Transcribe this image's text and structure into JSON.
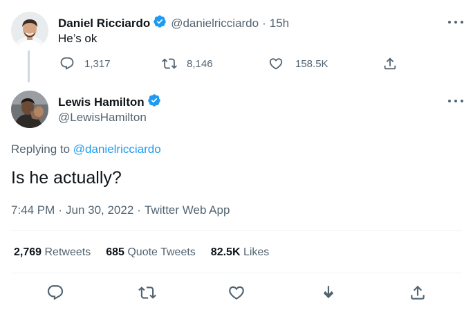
{
  "parent_tweet": {
    "author_name": "Daniel Ricciardo",
    "author_handle": "@danielricciardo",
    "separator": "·",
    "time_ago": "15h",
    "text": "He’s ok",
    "reply_count": "1,317",
    "retweet_count": "8,146",
    "like_count": "158.5K"
  },
  "main_tweet": {
    "author_name": "Lewis Hamilton",
    "author_handle": "@LewisHamilton",
    "replying_prefix": "Replying to",
    "replying_handle": "@danielricciardo",
    "text": "Is he actually?",
    "time": "7:44 PM",
    "date": "Jun 30, 2022",
    "source": "Twitter Web App",
    "meta_separator": "·",
    "stats": {
      "retweets_value": "2,769",
      "retweets_label": "Retweets",
      "quotes_value": "685",
      "quotes_label": "Quote Tweets",
      "likes_value": "82.5K",
      "likes_label": "Likes"
    }
  },
  "colors": {
    "link": "#1d9bf0",
    "verified": "#1d9bf0",
    "secondary_text": "#536471",
    "primary_text": "#0f1419",
    "divider": "#eff3f4"
  },
  "icons": {
    "verified": "verified-badge-icon",
    "reply": "reply-icon",
    "retweet": "retweet-icon",
    "like": "heart-icon",
    "share": "share-icon",
    "bookmark": "bookmark-icon",
    "more": "more-icon"
  }
}
